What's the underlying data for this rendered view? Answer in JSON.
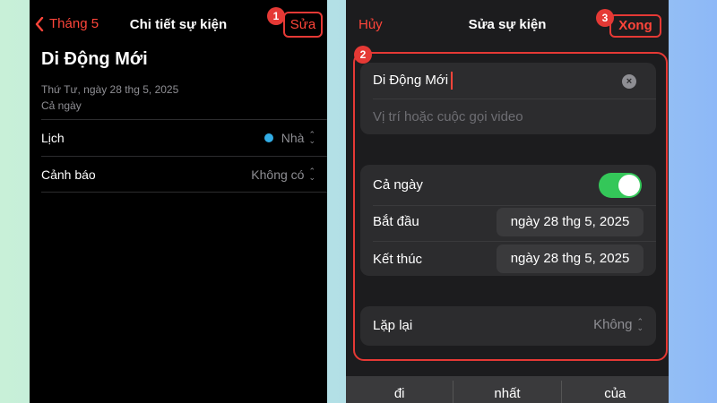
{
  "left_screen": {
    "nav": {
      "back_label": "Tháng 5",
      "title": "Chi tiết sự kiện",
      "edit_label": "Sửa"
    },
    "event": {
      "title": "Di Động Mới",
      "date": "Thứ Tư, ngày 28 thg 5, 2025",
      "all_day": "Cả ngày"
    },
    "rows": [
      {
        "label": "Lịch",
        "value": "Nhà",
        "calendar_color": "#32ade6"
      },
      {
        "label": "Cảnh báo",
        "value": "Không có"
      }
    ]
  },
  "right_screen": {
    "nav": {
      "cancel_label": "Hủy",
      "title": "Sửa sự kiện",
      "done_label": "Xong"
    },
    "title_field": {
      "value": "Di Động Mới",
      "location_placeholder": "Vị trí hoặc cuộc gọi video"
    },
    "all_day": {
      "label": "Cả ngày",
      "enabled": true
    },
    "start": {
      "label": "Bắt đầu",
      "value": "ngày 28 thg 5, 2025"
    },
    "end": {
      "label": "Kết thúc",
      "value": "ngày 28 thg 5, 2025"
    },
    "repeat": {
      "label": "Lặp lại",
      "value": "Không"
    },
    "keyboard_suggestions": [
      "đi",
      "nhất",
      "của"
    ]
  },
  "callouts": [
    "1",
    "2",
    "3"
  ],
  "colors": {
    "accent": "#ff453a",
    "highlight": "#e53935",
    "toggle_on": "#34c759"
  }
}
